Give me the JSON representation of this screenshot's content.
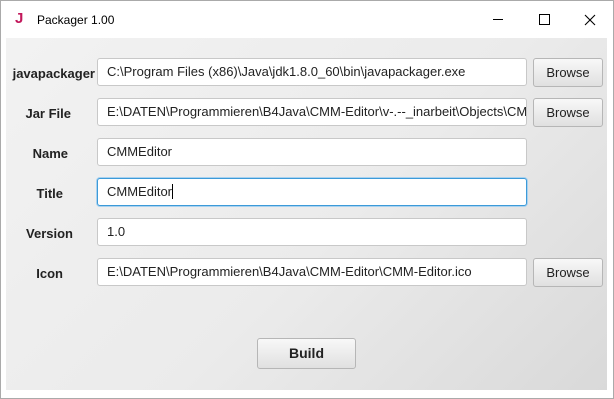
{
  "window": {
    "title": "Packager 1.00",
    "icon": "J"
  },
  "form": {
    "javapackager": {
      "label": "javapackager",
      "value": "C:\\Program Files (x86)\\Java\\jdk1.8.0_60\\bin\\javapackager.exe",
      "button": "Browse"
    },
    "jarfile": {
      "label": "Jar File",
      "value": "E:\\DATEN\\Programmieren\\B4Java\\CMM-Editor\\v-.--_inarbeit\\Objects\\CMM-Editor.jar",
      "button": "Browse"
    },
    "name": {
      "label": "Name",
      "value": "CMMEditor"
    },
    "title": {
      "label": "Title",
      "value": "CMMEditor"
    },
    "version": {
      "label": "Version",
      "value": "1.0"
    },
    "icon": {
      "label": "Icon",
      "value": "E:\\DATEN\\Programmieren\\B4Java\\CMM-Editor\\CMM-Editor.ico",
      "button": "Browse"
    }
  },
  "build_button": "Build",
  "colors": {
    "focus": "#3c9ad8",
    "app_icon": "#c2185b"
  }
}
